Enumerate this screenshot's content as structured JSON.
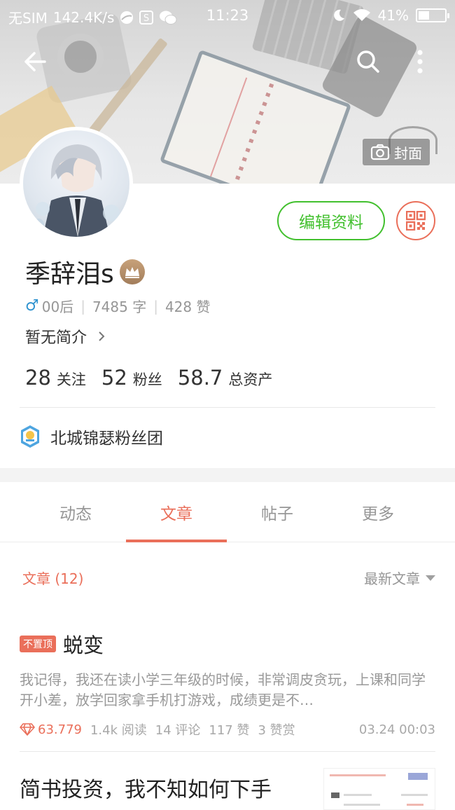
{
  "status_bar": {
    "carrier": "无SIM",
    "net_speed": "142.4K/s",
    "time": "11:23",
    "battery": "41%",
    "battery_level": 0.41
  },
  "cover": {
    "cover_label": "封面"
  },
  "profile": {
    "username": "季辞泪s",
    "gender_symbol": "♂",
    "age_group": "00后",
    "word_count": "7485 字",
    "likes": "428 赞",
    "intro": "暂无简介",
    "edit_label": "编辑资料",
    "stats": {
      "following_count": "28",
      "following_label": "关注",
      "followers_count": "52",
      "followers_label": "粉丝",
      "assets_count": "58.7",
      "assets_label": "总资产"
    },
    "fanclub": "北城锦瑟粉丝团"
  },
  "tabs": {
    "dynamic": "动态",
    "articles": "文章",
    "posts": "帖子",
    "more": "更多"
  },
  "list": {
    "count_label": "文章 (12)",
    "sort_label": "最新文章"
  },
  "articles": [
    {
      "badge": "不置顶",
      "title": "蜕变",
      "abstract": "我记得，我还在读小学三年级的时候，非常调皮贪玩，上课和同学开小差，放学回家拿手机打游戏，成绩更是不…",
      "diamonds": "63.779",
      "reads": "1.4k 阅读",
      "comments": "14 评论",
      "likes": "117 赞",
      "rewards": "3 赞赏",
      "date": "03.24 00:03"
    },
    {
      "title": "简书投资，我不知如何下手"
    }
  ],
  "colors": {
    "accent": "#ea6f5a",
    "green": "#42c02e"
  }
}
